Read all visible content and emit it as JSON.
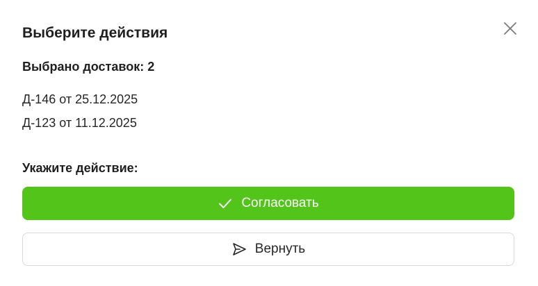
{
  "modal": {
    "title": "Выберите действия",
    "selected_count_label": "Выбрано доставок: 2",
    "deliveries": [
      "Д-146 от 25.12.2025",
      "Д-123 от 11.12.2025"
    ],
    "action_prompt": "Укажите действие:",
    "approve_label": "Согласовать",
    "return_label": "Вернуть",
    "close_icon": "close-icon"
  },
  "colors": {
    "primary_green": "#52c41a",
    "text": "#1f1f1f",
    "border": "#d9d9d9"
  }
}
